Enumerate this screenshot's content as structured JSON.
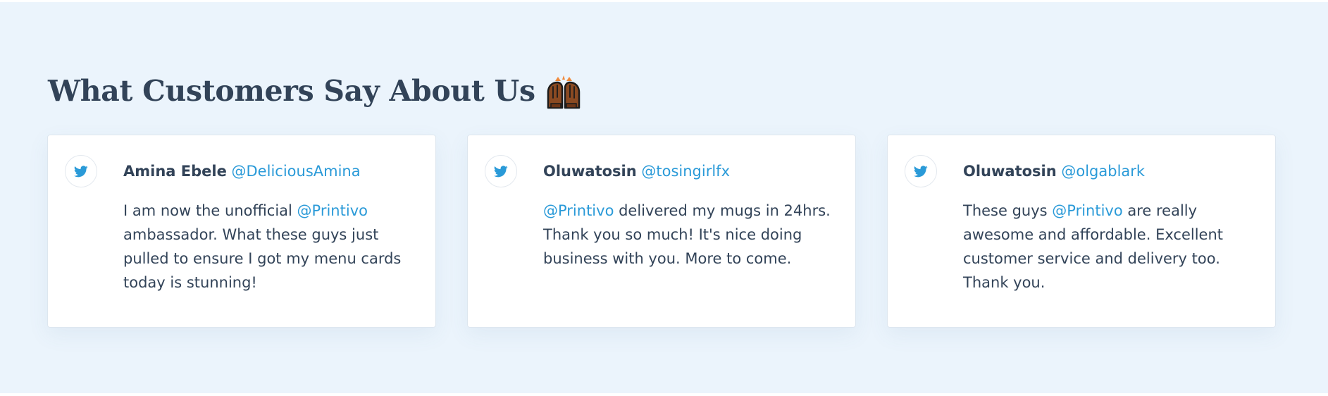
{
  "section": {
    "heading": "What Customers Say About Us",
    "heading_emoji": "raised-hands-emoji",
    "background": "#ebf4fc"
  },
  "colors": {
    "text": "#324358",
    "link": "#2a9ad8",
    "twitter": "#2a9ad8"
  },
  "testimonials": [
    {
      "icon": "twitter-icon",
      "author": "Amina Ebele",
      "handle": "@DeliciousAmina",
      "mention": "@Printivo",
      "text_before": "I am now the unofficial ",
      "text_after": " ambassador. What these guys just pulled to ensure I got my menu cards today is stunning!"
    },
    {
      "icon": "twitter-icon",
      "author": "Oluwatosin",
      "handle": "@tosingirlfx",
      "mention": "@Printivo",
      "text_before": "",
      "text_after": " delivered my mugs in 24hrs. Thank you so much! It's nice doing business with you. More to come."
    },
    {
      "icon": "twitter-icon",
      "author": "Oluwatosin",
      "handle": "@olgablark",
      "mention": "@Printivo",
      "text_before": "These guys ",
      "text_after": " are really awesome and affordable. Excellent customer service and delivery too. Thank you."
    }
  ]
}
